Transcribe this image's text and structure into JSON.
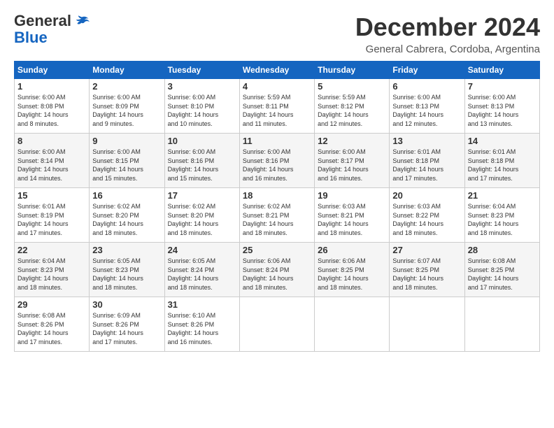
{
  "header": {
    "logo_general": "General",
    "logo_blue": "Blue",
    "month_title": "December 2024",
    "location": "General Cabrera, Cordoba, Argentina"
  },
  "calendar": {
    "days_of_week": [
      "Sunday",
      "Monday",
      "Tuesday",
      "Wednesday",
      "Thursday",
      "Friday",
      "Saturday"
    ],
    "weeks": [
      [
        {
          "day": "",
          "info": ""
        },
        {
          "day": "2",
          "info": "Sunrise: 6:00 AM\nSunset: 8:09 PM\nDaylight: 14 hours\nand 9 minutes."
        },
        {
          "day": "3",
          "info": "Sunrise: 6:00 AM\nSunset: 8:10 PM\nDaylight: 14 hours\nand 10 minutes."
        },
        {
          "day": "4",
          "info": "Sunrise: 5:59 AM\nSunset: 8:11 PM\nDaylight: 14 hours\nand 11 minutes."
        },
        {
          "day": "5",
          "info": "Sunrise: 5:59 AM\nSunset: 8:12 PM\nDaylight: 14 hours\nand 12 minutes."
        },
        {
          "day": "6",
          "info": "Sunrise: 6:00 AM\nSunset: 8:13 PM\nDaylight: 14 hours\nand 12 minutes."
        },
        {
          "day": "7",
          "info": "Sunrise: 6:00 AM\nSunset: 8:13 PM\nDaylight: 14 hours\nand 13 minutes."
        }
      ],
      [
        {
          "day": "1",
          "info": "Sunrise: 6:00 AM\nSunset: 8:08 PM\nDaylight: 14 hours\nand 8 minutes.",
          "first_col": true
        },
        {
          "day": "8",
          "info": ""
        },
        {
          "day": "9",
          "info": "Sunrise: 6:00 AM\nSunset: 8:15 PM\nDaylight: 14 hours\nand 15 minutes."
        },
        {
          "day": "10",
          "info": "Sunrise: 6:00 AM\nSunset: 8:16 PM\nDaylight: 14 hours\nand 15 minutes."
        },
        {
          "day": "11",
          "info": "Sunrise: 6:00 AM\nSunset: 8:16 PM\nDaylight: 14 hours\nand 16 minutes."
        },
        {
          "day": "12",
          "info": "Sunrise: 6:00 AM\nSunset: 8:17 PM\nDaylight: 14 hours\nand 16 minutes."
        },
        {
          "day": "13",
          "info": "Sunrise: 6:01 AM\nSunset: 8:18 PM\nDaylight: 14 hours\nand 17 minutes."
        },
        {
          "day": "14",
          "info": "Sunrise: 6:01 AM\nSunset: 8:18 PM\nDaylight: 14 hours\nand 17 minutes."
        }
      ],
      [
        {
          "day": "15",
          "info": "Sunrise: 6:01 AM\nSunset: 8:19 PM\nDaylight: 14 hours\nand 17 minutes."
        },
        {
          "day": "16",
          "info": "Sunrise: 6:02 AM\nSunset: 8:20 PM\nDaylight: 14 hours\nand 18 minutes."
        },
        {
          "day": "17",
          "info": "Sunrise: 6:02 AM\nSunset: 8:20 PM\nDaylight: 14 hours\nand 18 minutes."
        },
        {
          "day": "18",
          "info": "Sunrise: 6:02 AM\nSunset: 8:21 PM\nDaylight: 14 hours\nand 18 minutes."
        },
        {
          "day": "19",
          "info": "Sunrise: 6:03 AM\nSunset: 8:21 PM\nDaylight: 14 hours\nand 18 minutes."
        },
        {
          "day": "20",
          "info": "Sunrise: 6:03 AM\nSunset: 8:22 PM\nDaylight: 14 hours\nand 18 minutes."
        },
        {
          "day": "21",
          "info": "Sunrise: 6:04 AM\nSunset: 8:23 PM\nDaylight: 14 hours\nand 18 minutes."
        }
      ],
      [
        {
          "day": "22",
          "info": "Sunrise: 6:04 AM\nSunset: 8:23 PM\nDaylight: 14 hours\nand 18 minutes."
        },
        {
          "day": "23",
          "info": "Sunrise: 6:05 AM\nSunset: 8:23 PM\nDaylight: 14 hours\nand 18 minutes."
        },
        {
          "day": "24",
          "info": "Sunrise: 6:05 AM\nSunset: 8:24 PM\nDaylight: 14 hours\nand 18 minutes."
        },
        {
          "day": "25",
          "info": "Sunrise: 6:06 AM\nSunset: 8:24 PM\nDaylight: 14 hours\nand 18 minutes."
        },
        {
          "day": "26",
          "info": "Sunrise: 6:06 AM\nSunset: 8:25 PM\nDaylight: 14 hours\nand 18 minutes."
        },
        {
          "day": "27",
          "info": "Sunrise: 6:07 AM\nSunset: 8:25 PM\nDaylight: 14 hours\nand 18 minutes."
        },
        {
          "day": "28",
          "info": "Sunrise: 6:08 AM\nSunset: 8:25 PM\nDaylight: 14 hours\nand 17 minutes."
        }
      ],
      [
        {
          "day": "29",
          "info": "Sunrise: 6:08 AM\nSunset: 8:26 PM\nDaylight: 14 hours\nand 17 minutes."
        },
        {
          "day": "30",
          "info": "Sunrise: 6:09 AM\nSunset: 8:26 PM\nDaylight: 14 hours\nand 17 minutes."
        },
        {
          "day": "31",
          "info": "Sunrise: 6:10 AM\nSunset: 8:26 PM\nDaylight: 14 hours\nand 16 minutes."
        },
        {
          "day": "",
          "info": ""
        },
        {
          "day": "",
          "info": ""
        },
        {
          "day": "",
          "info": ""
        },
        {
          "day": "",
          "info": ""
        }
      ]
    ]
  }
}
